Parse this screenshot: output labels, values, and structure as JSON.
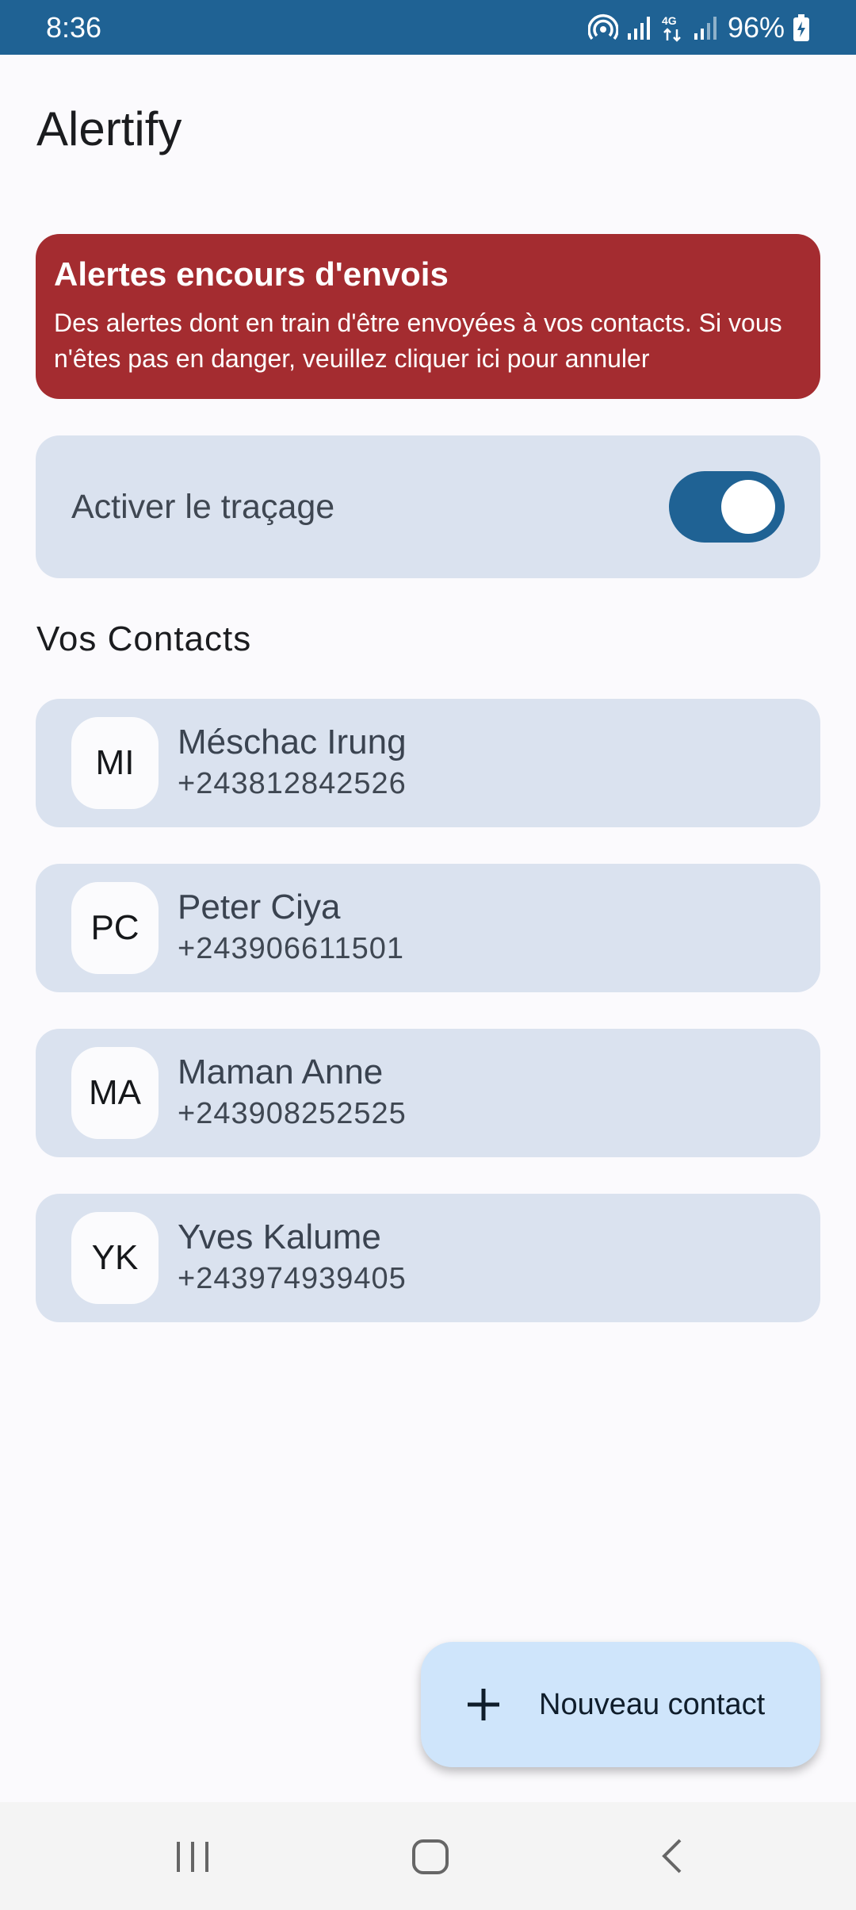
{
  "status_bar": {
    "time": "8:36",
    "battery": "96%",
    "icons": [
      "hotspot-icon",
      "signal-icon",
      "4g-icon",
      "signal-icon",
      "battery-charging-icon"
    ]
  },
  "app": {
    "title": "Alertify"
  },
  "alert": {
    "title": "Alertes encours d'envois",
    "body": "Des alertes dont en train d'être envoyées à vos contacts. Si vous n'êtes pas en danger, veuillez cliquer ici pour annuler",
    "color": "#a42c30"
  },
  "tracking": {
    "label": "Activer le traçage",
    "enabled": true
  },
  "contacts_section": {
    "title": "Vos Contacts"
  },
  "contacts": [
    {
      "initials": "MI",
      "name": "Méschac Irung",
      "phone": "+243812842526"
    },
    {
      "initials": "PC",
      "name": "Peter Ciya",
      "phone": "+243906611501"
    },
    {
      "initials": "MA",
      "name": "Maman Anne",
      "phone": "+243908252525"
    },
    {
      "initials": "YK",
      "name": "Yves Kalume",
      "phone": "+243974939405"
    }
  ],
  "fab": {
    "label": "Nouveau contact",
    "icon": "plus-icon"
  },
  "nav": {
    "icons": [
      "recents-icon",
      "home-icon",
      "back-icon"
    ]
  },
  "colors": {
    "primary": "#1f6294",
    "card": "#dae2ef",
    "fab": "#cfe5fb"
  }
}
